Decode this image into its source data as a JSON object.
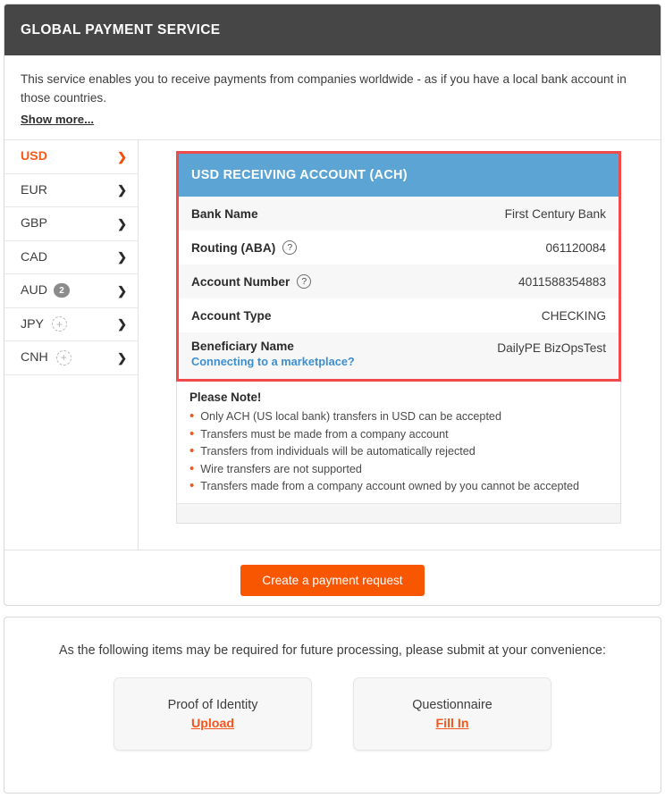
{
  "header": {
    "title": "GLOBAL PAYMENT SERVICE"
  },
  "intro": {
    "text": "This service enables you to receive payments from companies worldwide - as if you have a local bank account in those countries.",
    "show_more": "Show more..."
  },
  "sidebar": {
    "items": [
      {
        "code": "USD",
        "active": true,
        "badge": null,
        "add": false,
        "chevron": "❯"
      },
      {
        "code": "EUR",
        "active": false,
        "badge": null,
        "add": false,
        "chevron": "❯"
      },
      {
        "code": "GBP",
        "active": false,
        "badge": null,
        "add": false,
        "chevron": "❯"
      },
      {
        "code": "CAD",
        "active": false,
        "badge": null,
        "add": false,
        "chevron": "❯"
      },
      {
        "code": "AUD",
        "active": false,
        "badge": "2",
        "add": false,
        "chevron": "❯"
      },
      {
        "code": "JPY",
        "active": false,
        "badge": null,
        "add": true,
        "chevron": "❯"
      },
      {
        "code": "CNH",
        "active": false,
        "badge": null,
        "add": true,
        "chevron": "❯"
      }
    ],
    "add_glyph": "+"
  },
  "account": {
    "panel_title": "USD RECEIVING ACCOUNT (ACH)",
    "rows": [
      {
        "label": "Bank Name",
        "value": "First Century Bank",
        "help": false
      },
      {
        "label": "Routing (ABA)",
        "value": "061120084",
        "help": true
      },
      {
        "label": "Account Number",
        "value": "4011588354883",
        "help": true
      },
      {
        "label": "Account Type",
        "value": "CHECKING",
        "help": false
      },
      {
        "label": "Beneficiary Name",
        "value": "DailyPE BizOpsTest",
        "help": false
      }
    ],
    "help_glyph": "?",
    "marketplace_link": "Connecting to a marketplace?",
    "highlight_color": "#f04a4a",
    "header_color": "#5ba4d3"
  },
  "note": {
    "title": "Please Note!",
    "bullet_glyph": "•",
    "items": [
      "Only ACH (US local bank) transfers in USD can be accepted",
      "Transfers must be made from a company account",
      "Transfers from individuals will be automatically rejected",
      "Wire transfers are not supported",
      "Transfers made from a company account owned by you cannot be accepted"
    ]
  },
  "cta": {
    "label": "Create a payment request",
    "color": "#f95602"
  },
  "docs": {
    "note": "As the following items may be required for future processing, please submit at your convenience:",
    "cards": [
      {
        "title": "Proof of Identity",
        "action": "Upload"
      },
      {
        "title": "Questionnaire",
        "action": "Fill In"
      }
    ]
  }
}
